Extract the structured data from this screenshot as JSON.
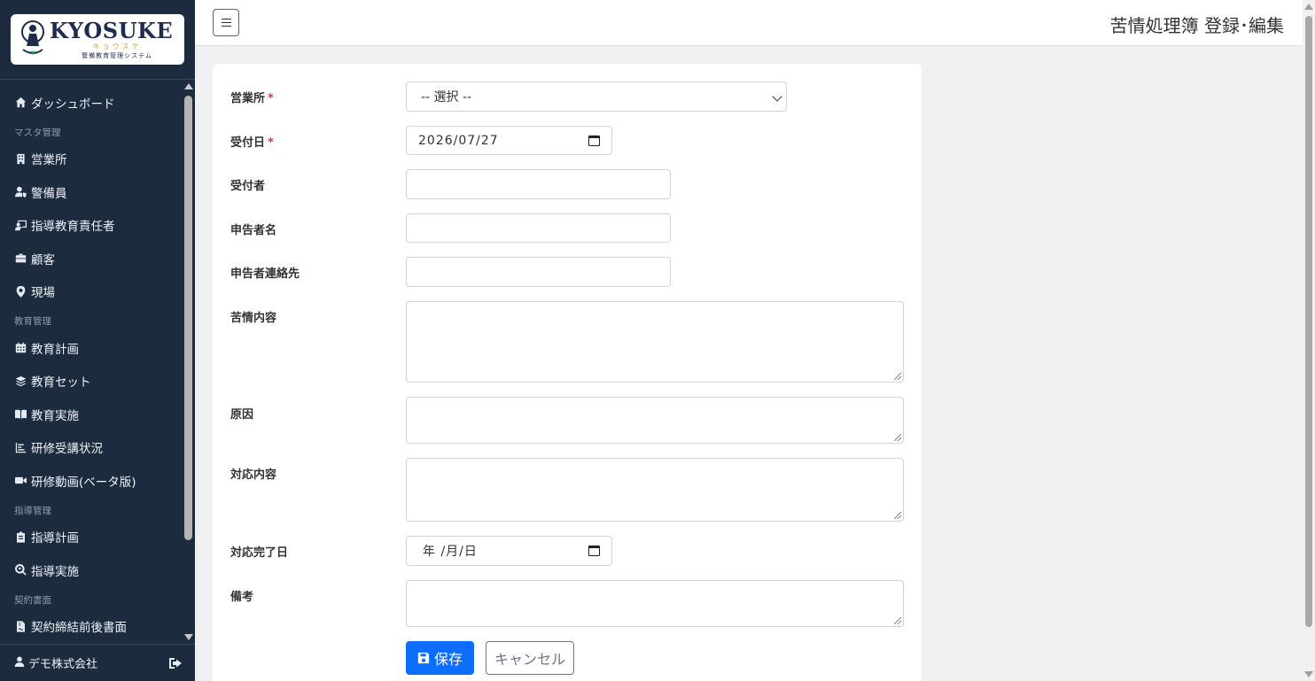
{
  "brand": {
    "name": "KYOSUKE",
    "kana": "キョウスケ",
    "tagline": "警備教育管理システム"
  },
  "header": {
    "title": "苦情処理簿 登録･編集",
    "menu_toggle_icon": "hamburger-icon"
  },
  "sidebar": {
    "dashboard": "ダッシュボード",
    "sections": {
      "master": "マスタ管理",
      "education": "教育管理",
      "guidance": "指導管理",
      "contract": "契約書面"
    },
    "items": {
      "offices": "営業所",
      "guards": "警備員",
      "instructors": "指導教育責任者",
      "customers": "顧客",
      "sites": "現場",
      "edu_plan": "教育計画",
      "edu_set": "教育セット",
      "edu_exec": "教育実施",
      "training_status": "研修受講状況",
      "training_video": "研修動画(ベータ版)",
      "guide_plan": "指導計画",
      "guide_exec": "指導実施",
      "contract_docs": "契約締結前後書面"
    },
    "user": "デモ株式会社"
  },
  "form": {
    "office": {
      "label": "営業所",
      "value": "-- 選択 --",
      "required": true
    },
    "received_date": {
      "label": "受付日",
      "value": "2026/07/27",
      "required": true
    },
    "receiver": {
      "label": "受付者",
      "value": ""
    },
    "reporter_name": {
      "label": "申告者名",
      "value": ""
    },
    "reporter_contact": {
      "label": "申告者連絡先",
      "value": ""
    },
    "complaint": {
      "label": "苦情内容",
      "value": ""
    },
    "cause": {
      "label": "原因",
      "value": ""
    },
    "response": {
      "label": "対応内容",
      "value": ""
    },
    "completion_date": {
      "label": "対応完了日",
      "value": "年 /月/日"
    },
    "notes": {
      "label": "備考",
      "value": ""
    },
    "required_mark": "*",
    "save_label": "保存",
    "cancel_label": "キャンセル"
  }
}
